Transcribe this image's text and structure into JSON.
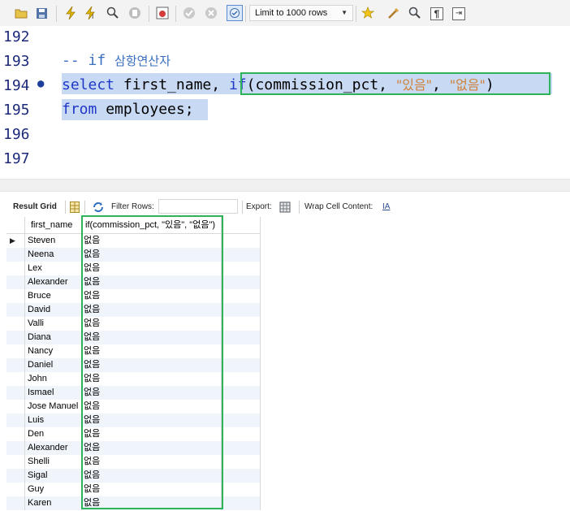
{
  "toolbar": {
    "icons": [
      "open-folder-icon",
      "save-icon",
      "execute-icon",
      "execute-current-icon",
      "explain-icon",
      "stop-icon",
      "toggle-results-icon",
      "commit-icon",
      "rollback-icon",
      "autocommit-icon",
      "beautify-icon",
      "find-icon",
      "invisible-chars-icon",
      "wrap-icon"
    ],
    "limit_label": "Limit to 1000 rows"
  },
  "editor": {
    "lines": [
      {
        "num": "192"
      },
      {
        "num": "193"
      },
      {
        "num": "194"
      },
      {
        "num": "195"
      },
      {
        "num": "196"
      },
      {
        "num": "197"
      }
    ],
    "comment_marker": "-- if",
    "comment_text": "삼항연산자",
    "kw_select": "select",
    "ident_first_name": "first_name,",
    "kw_if": "if",
    "if_args_start": "(commission_pct, ",
    "string1": "\"있음\"",
    "comma_sep": ", ",
    "string2": "\"없음\"",
    "close_paren": ")",
    "kw_from": "from",
    "table_name": "employees;"
  },
  "result_toolbar": {
    "result_grid_label": "Result Grid",
    "filter_rows_label": "Filter Rows:",
    "filter_value": "",
    "export_label": "Export:",
    "wrap_label": "Wrap Cell Content:"
  },
  "grid": {
    "columns": [
      "first_name",
      "if(commission_pct, \"있음\", \"없음\")"
    ],
    "rows": [
      [
        "Steven",
        "없음"
      ],
      [
        "Neena",
        "없음"
      ],
      [
        "Lex",
        "없음"
      ],
      [
        "Alexander",
        "없음"
      ],
      [
        "Bruce",
        "없음"
      ],
      [
        "David",
        "없음"
      ],
      [
        "Valli",
        "없음"
      ],
      [
        "Diana",
        "없음"
      ],
      [
        "Nancy",
        "없음"
      ],
      [
        "Daniel",
        "없음"
      ],
      [
        "John",
        "없음"
      ],
      [
        "Ismael",
        "없음"
      ],
      [
        "Jose Manuel",
        "없음"
      ],
      [
        "Luis",
        "없음"
      ],
      [
        "Den",
        "없음"
      ],
      [
        "Alexander",
        "없음"
      ],
      [
        "Shelli",
        "없음"
      ],
      [
        "Sigal",
        "없음"
      ],
      [
        "Guy",
        "없음"
      ],
      [
        "Karen",
        "없음"
      ]
    ]
  },
  "colors": {
    "keyword": "#2038c8",
    "string": "#d0813b",
    "selection": "#c8daf3",
    "highlight_box": "#2db45a"
  }
}
